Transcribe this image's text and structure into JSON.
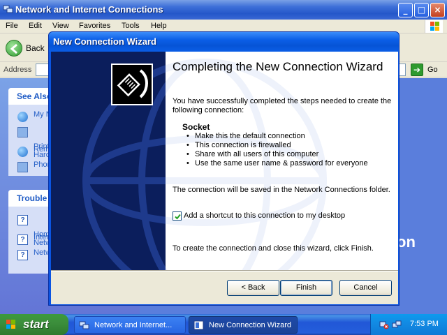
{
  "explorer": {
    "title": "Network and Internet Connections",
    "menu": [
      "File",
      "Edit",
      "View",
      "Favorites",
      "Tools",
      "Help"
    ],
    "back_label": "Back",
    "address_label": "Address",
    "go_label": "Go",
    "see_also": {
      "header": "See Also",
      "items": [
        "My N",
        "Print\nHard",
        "Rem",
        "Phon"
      ]
    },
    "troubleshooters": {
      "header": "Trouble",
      "items": [
        "Hom\nNetw",
        "Inter",
        "Netw"
      ]
    },
    "right_text": "on"
  },
  "wizard": {
    "title": "New Connection Wizard",
    "heading": "Completing the New Connection Wizard",
    "intro": "You have successfully completed the steps needed to create the following connection:",
    "connection_name": "Socket",
    "bullets": [
      "Make this the default connection",
      "This connection is firewalled",
      "Share with all users of this computer",
      "Use the same user name & password for everyone"
    ],
    "save_note": "The connection will be saved in the Network Connections folder.",
    "shortcut_label": "Add a shortcut to this connection to my desktop",
    "shortcut_checked": true,
    "finish_note": "To create the connection and close this wizard, click Finish.",
    "buttons": {
      "back": "< Back",
      "finish": "Finish",
      "cancel": "Cancel"
    }
  },
  "taskbar": {
    "start": "start",
    "tasks": [
      "Network and Internet...",
      "New Connection Wizard"
    ],
    "clock": "7:53 PM"
  },
  "colors": {
    "xp_blue": "#0a54e2",
    "wizard_left": "#0b1e5c",
    "link_blue": "#215dc6",
    "start_green": "#3c8f3c"
  }
}
